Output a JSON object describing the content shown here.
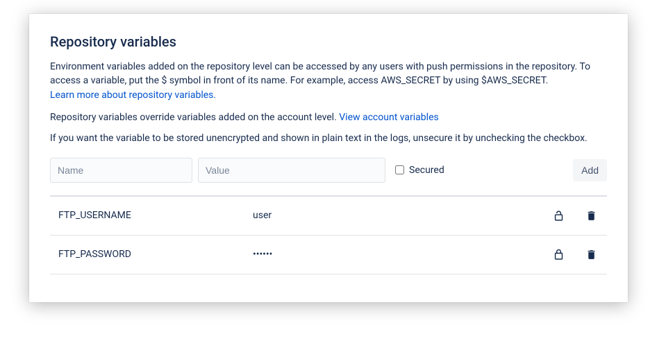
{
  "title": "Repository variables",
  "description_part1": "Environment variables added on the repository level can be accessed by any users with push permissions in the repository. To access a variable, put the $ symbol in front of its name. For example, access AWS_SECRET by using $AWS_SECRET.",
  "learn_more_link": "Learn more about repository variables.",
  "override_text": "Repository variables override variables added on the account level. ",
  "account_variables_link": "View account variables",
  "unsecure_text": "If you want the variable to be stored unencrypted and shown in plain text in the logs, unsecure it by unchecking the checkbox.",
  "form": {
    "name_placeholder": "Name",
    "value_placeholder": "Value",
    "secured_label": "Secured",
    "add_label": "Add"
  },
  "variables": [
    {
      "name": "FTP_USERNAME",
      "value": "user",
      "secured": false
    },
    {
      "name": "FTP_PASSWORD",
      "value": "••••••",
      "secured": true
    }
  ]
}
